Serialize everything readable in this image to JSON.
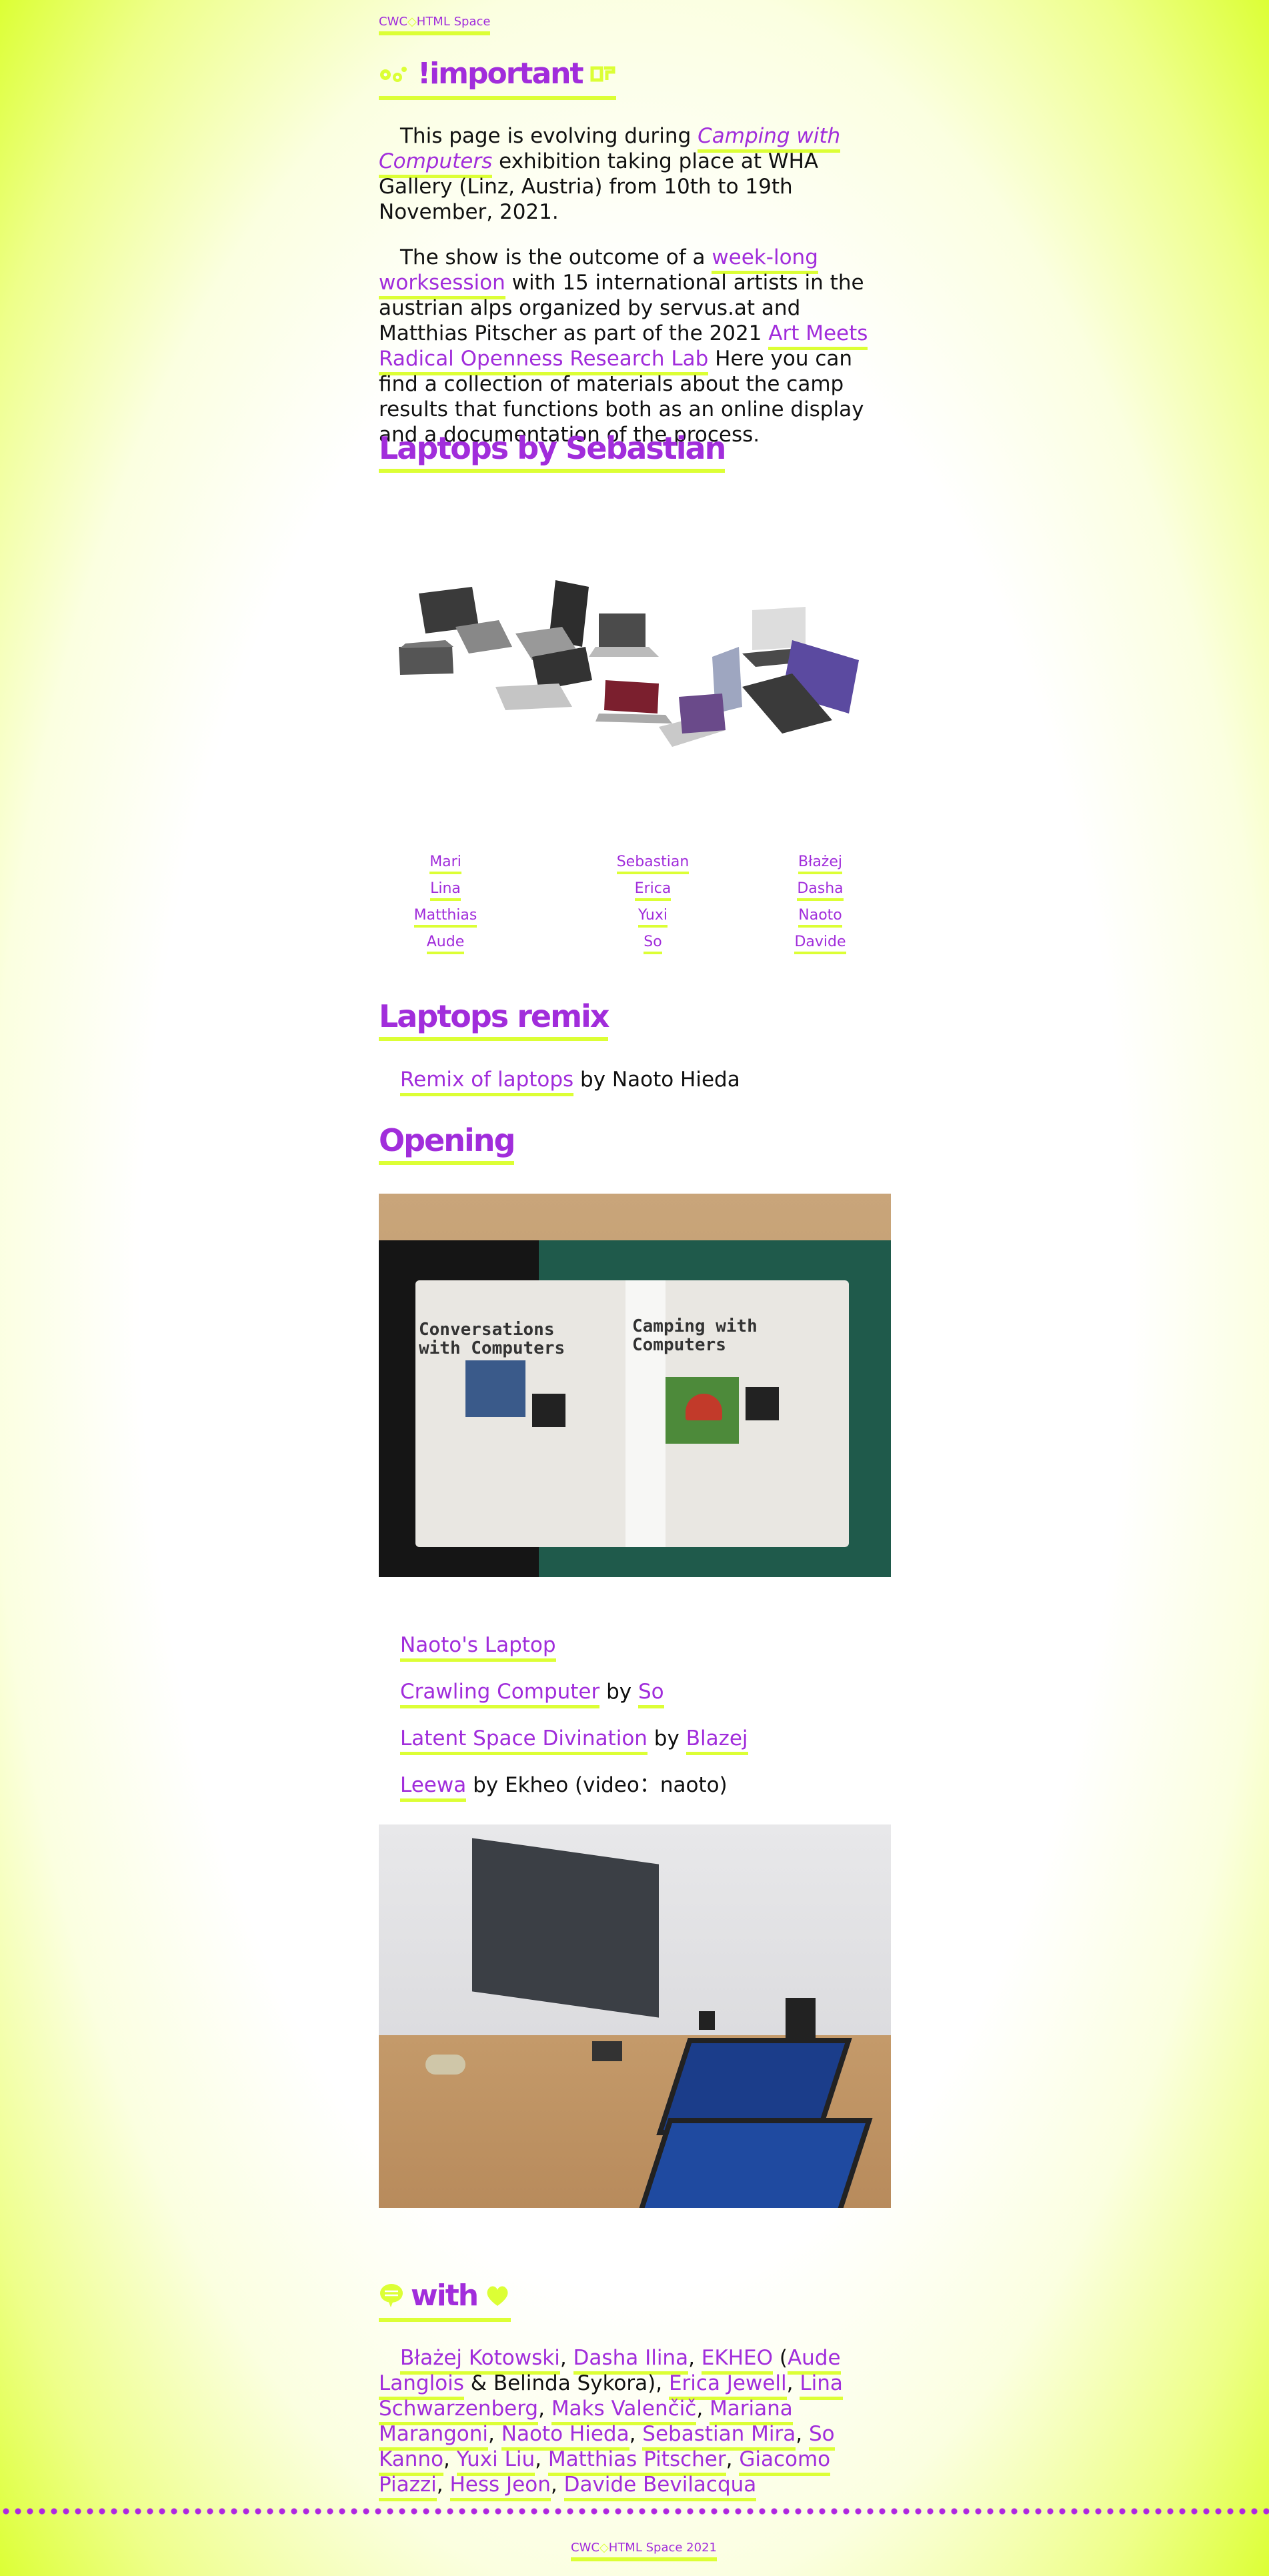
{
  "top_crumb": {
    "a": "CWC",
    "sep": "◇",
    "b": "HTML Space"
  },
  "important": {
    "title": "!important"
  },
  "intro": {
    "p1_before": "This page is evolving during ",
    "p1_link": "Camping with Computers",
    "p1_after": " exhibition taking place at WHA Gallery (Linz, Austria) from 10th to 19th November, 2021.",
    "p2_before": "The show is the outcome of a ",
    "p2_link1": "week-long worksession",
    "p2_mid": " with 15 international artists in the austrian alps organized by servus.at and Matthias Pitscher as part of the 2021 ",
    "p2_link2": "Art Meets Radical Openness Research Lab",
    "p2_after": " Here you can find a collection of materials about the camp results that functions both as an online display and a documentation of the process."
  },
  "laptops": {
    "title": "Laptops by Sebastian",
    "names_col1": [
      "Mari",
      "Lina",
      "Matthias",
      "Aude"
    ],
    "names_col2": [
      "Sebastian",
      "Erica",
      "Yuxi",
      "So"
    ],
    "names_col3": [
      "Błażej",
      "Dasha",
      "Naoto",
      "Davide"
    ]
  },
  "remix": {
    "title": "Laptops remix",
    "link": "Remix of laptops",
    "by": " by Naoto Hieda"
  },
  "opening": {
    "title": "Opening",
    "poster_left": "Conversations with Computers",
    "poster_right": "Camping with Computers",
    "works": [
      {
        "link": "Naoto's Laptop"
      },
      {
        "link": "Crawling Computer",
        "by": " by ",
        "author": "So"
      },
      {
        "link": "Latent Space Divination",
        "by": " by ",
        "author": "Blazej"
      },
      {
        "link": "Leewa",
        "by": " by Ekheo (video：naoto)"
      }
    ]
  },
  "with": {
    "title": "with",
    "people": [
      "Błażej Kotowski",
      "Dasha Ilina",
      "EKHEO",
      "Aude Langlois",
      "Erica Jewell",
      "Lina Schwarzenberg",
      "Maks Valenčič",
      "Mariana Marangoni",
      "Naoto Hieda",
      "Sebastian Mira",
      "So Kanno",
      "Yuxi Liu",
      "Matthias Pitscher",
      "Giacomo Piazzi",
      "Hess Jeon",
      "Davide Bevilacqua"
    ],
    "belinda": " & Belinda Sykora"
  },
  "footer": {
    "a": "CWC",
    "sep": "◇",
    "b": "HTML Space 2021"
  },
  "colors": {
    "accent": "#a12ddb",
    "highlight": "#dcff35"
  }
}
